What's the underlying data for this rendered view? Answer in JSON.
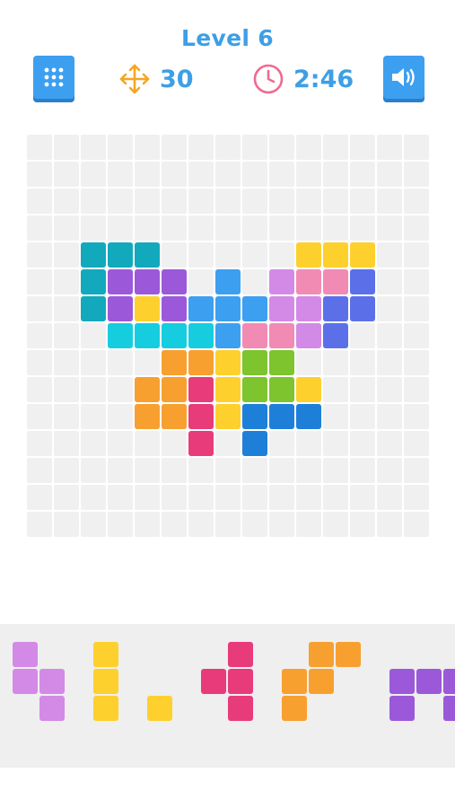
{
  "header": {
    "level": "Level 6",
    "moves": "30",
    "time": "2:46",
    "accent": "#3d9fe6",
    "move_icon_color": "#f5a623",
    "clock_icon_color": "#f06a8f"
  },
  "icons": {
    "menu": "grid-menu-icon",
    "moves": "move-arrows-icon",
    "timer": "clock-icon",
    "sound": "speaker-icon"
  },
  "colors": {
    "teal": "#12a9bd",
    "purple": "#9b59d9",
    "yellow": "#fdd02e",
    "blue": "#3d9ff0",
    "cyan": "#16cde0",
    "lavender": "#d38ae6",
    "pink": "#f28bb4",
    "indigo": "#5b70e8",
    "orange": "#f7a030",
    "magenta": "#e83b7a",
    "green": "#7dc42e",
    "darkblue": "#1e7fd9"
  },
  "board": {
    "cols": 15,
    "rows": 15,
    "empty_color": "#f0f0f0",
    "filled": [
      [
        4,
        2,
        "teal"
      ],
      [
        4,
        3,
        "teal"
      ],
      [
        4,
        4,
        "teal"
      ],
      [
        5,
        2,
        "teal"
      ],
      [
        6,
        2,
        "teal"
      ],
      [
        5,
        3,
        "purple"
      ],
      [
        5,
        4,
        "purple"
      ],
      [
        5,
        5,
        "purple"
      ],
      [
        6,
        3,
        "purple"
      ],
      [
        6,
        5,
        "purple"
      ],
      [
        6,
        4,
        "yellow"
      ],
      [
        5,
        7,
        "blue"
      ],
      [
        6,
        6,
        "blue"
      ],
      [
        6,
        7,
        "blue"
      ],
      [
        6,
        8,
        "blue"
      ],
      [
        7,
        7,
        "blue"
      ],
      [
        7,
        3,
        "cyan"
      ],
      [
        7,
        4,
        "cyan"
      ],
      [
        7,
        5,
        "cyan"
      ],
      [
        7,
        6,
        "cyan"
      ],
      [
        4,
        10,
        "yellow"
      ],
      [
        4,
        11,
        "yellow"
      ],
      [
        4,
        12,
        "yellow"
      ],
      [
        5,
        9,
        "lavender"
      ],
      [
        6,
        9,
        "lavender"
      ],
      [
        6,
        10,
        "lavender"
      ],
      [
        7,
        10,
        "lavender"
      ],
      [
        5,
        10,
        "pink"
      ],
      [
        5,
        11,
        "pink"
      ],
      [
        7,
        8,
        "pink"
      ],
      [
        7,
        9,
        "pink"
      ],
      [
        5,
        12,
        "indigo"
      ],
      [
        6,
        11,
        "indigo"
      ],
      [
        6,
        12,
        "indigo"
      ],
      [
        7,
        11,
        "indigo"
      ],
      [
        8,
        5,
        "orange"
      ],
      [
        8,
        6,
        "orange"
      ],
      [
        9,
        4,
        "orange"
      ],
      [
        9,
        5,
        "orange"
      ],
      [
        10,
        4,
        "orange"
      ],
      [
        10,
        5,
        "orange"
      ],
      [
        9,
        6,
        "magenta"
      ],
      [
        10,
        6,
        "magenta"
      ],
      [
        11,
        6,
        "magenta"
      ],
      [
        8,
        7,
        "yellow"
      ],
      [
        9,
        7,
        "yellow"
      ],
      [
        10,
        7,
        "yellow"
      ],
      [
        9,
        10,
        "yellow"
      ],
      [
        8,
        8,
        "green"
      ],
      [
        8,
        9,
        "green"
      ],
      [
        9,
        8,
        "green"
      ],
      [
        9,
        9,
        "green"
      ],
      [
        10,
        8,
        "darkblue"
      ],
      [
        10,
        9,
        "darkblue"
      ],
      [
        10,
        10,
        "darkblue"
      ],
      [
        11,
        8,
        "darkblue"
      ]
    ]
  },
  "tray": {
    "background": "#efefef",
    "pieces": [
      {
        "color": "lavender",
        "cells": [
          [
            0,
            0
          ],
          [
            1,
            0
          ],
          [
            1,
            1
          ],
          [
            2,
            1
          ]
        ]
      },
      {
        "color": "yellow",
        "cells": [
          [
            0,
            0
          ],
          [
            1,
            0
          ],
          [
            2,
            0
          ]
        ]
      },
      {
        "color": "yellow",
        "cells": [
          [
            0,
            0
          ]
        ]
      },
      {
        "color": "magenta",
        "cells": [
          [
            0,
            1
          ],
          [
            1,
            0
          ],
          [
            1,
            1
          ],
          [
            2,
            1
          ]
        ]
      },
      {
        "color": "orange",
        "cells": [
          [
            0,
            1
          ],
          [
            0,
            2
          ],
          [
            1,
            0
          ],
          [
            1,
            1
          ],
          [
            2,
            0
          ]
        ]
      },
      {
        "color": "purple",
        "cells": [
          [
            0,
            0
          ],
          [
            0,
            1
          ],
          [
            0,
            2
          ],
          [
            1,
            0
          ],
          [
            1,
            2
          ]
        ]
      }
    ]
  }
}
